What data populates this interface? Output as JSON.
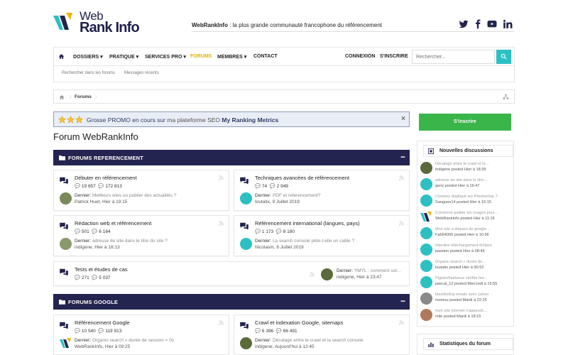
{
  "brand": {
    "name_line1": "Web",
    "name_line2": "Rank Info",
    "tagline_bold": "WebRankInfo",
    "tagline_rest": " : la plus grande communauté francophone du référencement"
  },
  "social": [
    "twitter-icon",
    "facebook-icon",
    "youtube-icon",
    "linkedin-icon"
  ],
  "colors": {
    "navy": "#23244f",
    "teal": "#2dc0c3",
    "green": "#3ab54a",
    "gold": "#e3b100"
  },
  "nav": {
    "items": [
      "DOSSIERS",
      "PRATIQUE",
      "SERVICES PRO",
      "FORUMS",
      "MEMBRES",
      "CONTACT"
    ],
    "login": "CONNEXION",
    "register": "S'INSCRIRE",
    "search_placeholder": "Rechercher..."
  },
  "subnav": {
    "items": [
      "Rechercher dans les forums",
      "Messages récents"
    ]
  },
  "breadcrumb": {
    "current": "Forums"
  },
  "promo": {
    "part1": "Grosse PROMO en cours sur",
    "part2": " ma plateforme SEO ",
    "part3": "My Ranking Metrics",
    "close": "×"
  },
  "page_title": "Forum WebRankInfo",
  "sections": [
    {
      "title": "FORUMS REFERENCEMENT",
      "forums": [
        {
          "title": "Débuter en référencement",
          "threads": "19 657",
          "posts": "172 813",
          "last_label": "Dernier:",
          "last_subject": "Meilleurs sites ou publier des actualités ?",
          "last_meta": "Patrick Huet, Hier à 19:15"
        },
        {
          "title": "Techniques avancées de référencement",
          "threads": "74",
          "posts": "2 949",
          "last_label": "Dernier:",
          "last_subject": "PDF et referencement?",
          "last_meta": "toutatix, 9 Juillet 2019"
        },
        {
          "title": "Rédaction web et référencement",
          "threads": "501",
          "posts": "6 164",
          "last_label": "Dernier:",
          "last_subject": "adresse de site dans le titre du site ?",
          "last_meta": "indigene, Hier à 18:13"
        },
        {
          "title": "Référencement international (langues, pays)",
          "threads": "1 173",
          "posts": "8 180",
          "last_label": "Dernier:",
          "last_subject": "La search console pète-t-elle un cable ?",
          "last_meta": "Nicolasm, 8 Juillet 2019"
        },
        {
          "title": "Tests et études de cas",
          "threads": "271",
          "posts": "5 037",
          "last_label": "Dernier:",
          "last_subject": "YMYL : comment sor...",
          "last_meta": "indigene, Hier à 23:47"
        }
      ]
    },
    {
      "title": "FORUMS GOOGLE",
      "forums": [
        {
          "title": "Référencement Google",
          "threads": "10 540",
          "posts": "119 913",
          "last_label": "Dernier:",
          "last_subject": "Organic search » durée de session = 0s",
          "last_meta": "WebRankInfo, Hier à 09:25"
        },
        {
          "title": "Crawl et indexation Google, sitemaps",
          "threads": "6 396",
          "posts": "66 491",
          "last_label": "Dernier:",
          "last_subject": "Décalage entre le crawl et la search console",
          "last_meta": "indigene, Aujourd'hui à 12:45"
        }
      ]
    }
  ],
  "sidebar": {
    "signup": "S'inscrire",
    "new_discussions_title": "Nouvelles discussions",
    "discussions": [
      {
        "subject": "Décalage entre le crawl et la...",
        "meta": "indigene posted Hier à 18:39"
      },
      {
        "subject": "adresse de site dans le titre...",
        "meta": "genz posted Hier à 16:47"
      },
      {
        "subject": "Contenu dupliqué sur Prestashop ?",
        "meta": "Sanguen14 posted Hier à 16:15"
      },
      {
        "subject": "Comment auditer les images pour...",
        "meta": "WebRankInfo posted Hier à 11:16"
      },
      {
        "subject": "Mon site a disparu de google...",
        "meta": "Fab64000 posted Hier à 10:36"
      },
      {
        "subject": "Interdire téléchargement fichiers",
        "meta": "passion posted Hier à 08:49"
      },
      {
        "subject": "Organic search » durée de...",
        "meta": "toutatix posted Hier à 00:52"
      },
      {
        "subject": "Pigiste/freelance vérifier les...",
        "meta": "pascal_12 posted Mercredi à 15:55"
      },
      {
        "subject": "blacklisting emails avec yahoo",
        "meta": "momou posted Mardi à 22:25"
      },
      {
        "subject": "mon site internet n'apparaît...",
        "meta": "mile posted Mardi à 18:15"
      }
    ],
    "stats_title": "Statistiques du forum"
  }
}
